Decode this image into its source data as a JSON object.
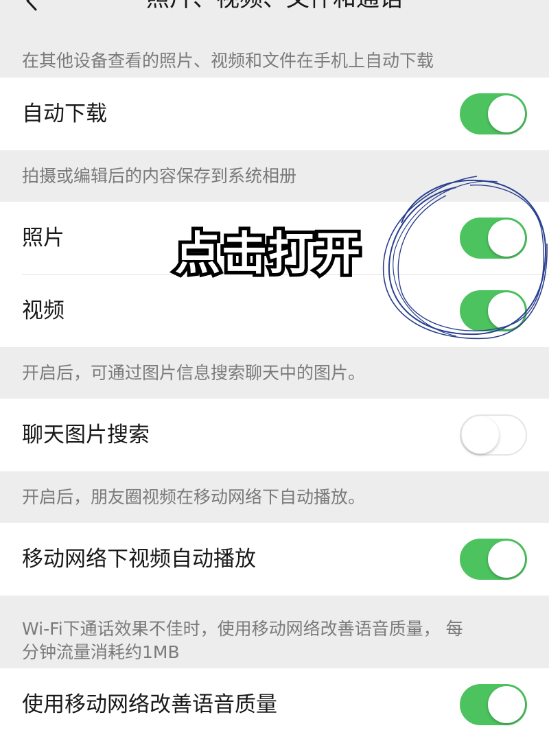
{
  "navbar": {
    "title": "照片、视频、文件和通话",
    "back_icon": "chevron-left-icon"
  },
  "sections": [
    {
      "header": "在其他设备查看的照片、视频和文件在手机上自动下载",
      "rows": [
        {
          "label": "自动下载",
          "enabled": true
        }
      ]
    },
    {
      "header": "拍摄或编辑后的内容保存到系统相册",
      "rows": [
        {
          "label": "照片",
          "enabled": true
        },
        {
          "label": "视频",
          "enabled": true
        }
      ]
    },
    {
      "header": "开启后，可通过图片信息搜索聊天中的图片。",
      "rows": [
        {
          "label": "聊天图片搜索",
          "enabled": false
        }
      ]
    },
    {
      "header": "开启后，朋友圈视频在移动网络下自动播放。",
      "rows": [
        {
          "label": "移动网络下视频自动播放",
          "enabled": true
        }
      ]
    },
    {
      "header_line1": "Wi-Fi下通话效果不佳时，使用移动网络改善语音质量， 每",
      "header_line2": "分钟流量消耗约1MB",
      "rows": [
        {
          "label": "使用移动网络改善语音质量",
          "enabled": true
        }
      ]
    }
  ],
  "annotation": {
    "caption": "点击打开",
    "scribble_color": "#2a3f8f"
  },
  "colors": {
    "toggle_on": "#4cc35f",
    "background": "#ededed",
    "row_background": "#ffffff",
    "header_text": "#7a7a7a"
  }
}
